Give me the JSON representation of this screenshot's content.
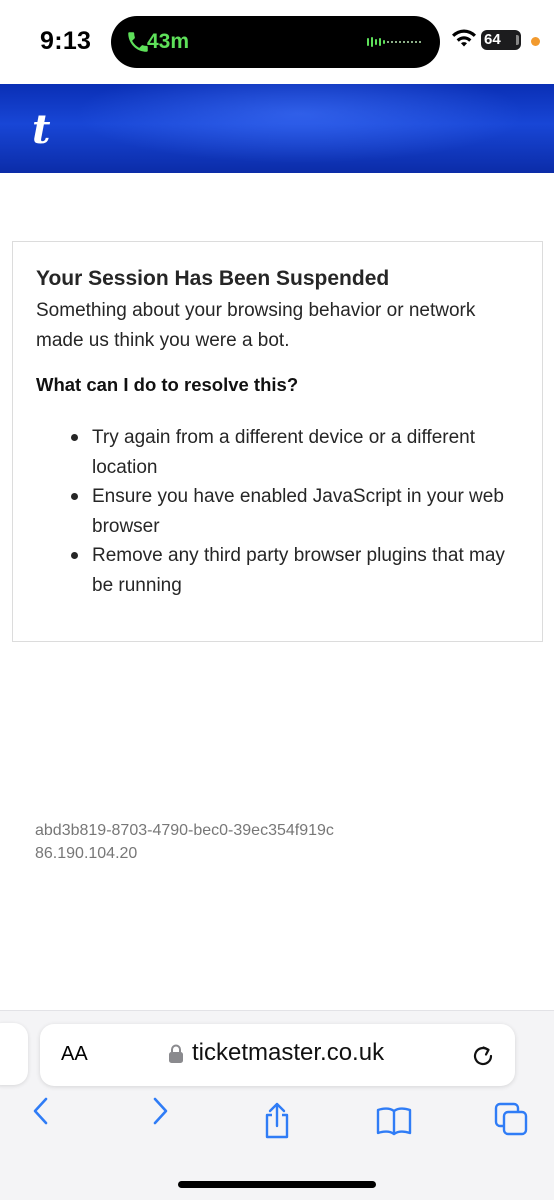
{
  "status_bar": {
    "time": "9:13",
    "call_duration": "43m",
    "battery_level": "64",
    "icons": [
      "phone-icon",
      "waveform-icon",
      "wifi-icon",
      "battery-icon"
    ],
    "colors": {
      "call_green": "#5ee05a",
      "privacy_dot": "#f29a2e"
    }
  },
  "banner": {
    "logo_text": "t",
    "colors": {
      "background": "#1846d6",
      "logo": "#ffffff"
    }
  },
  "message": {
    "title": "Your Session Has Been Suspended",
    "description": "Something about your browsing behavior or network made us think you were a bot.",
    "subheading": "What can I do to resolve this?",
    "tips": [
      "Try again from a different device or a different location",
      "Ensure you have enabled JavaScript in your web browser",
      "Remove any third party browser plugins that may be running"
    ]
  },
  "reference": {
    "id": "abd3b819-8703-4790-bec0-39ec354f919c",
    "ip": "86.190.104.20"
  },
  "browser": {
    "text_size_label": "AA",
    "url": "ticketmaster.co.uk",
    "accent": "#2f7cf6",
    "toolbar_icons": [
      "back-icon",
      "forward-icon",
      "share-icon",
      "bookmarks-icon",
      "tabs-icon"
    ]
  }
}
